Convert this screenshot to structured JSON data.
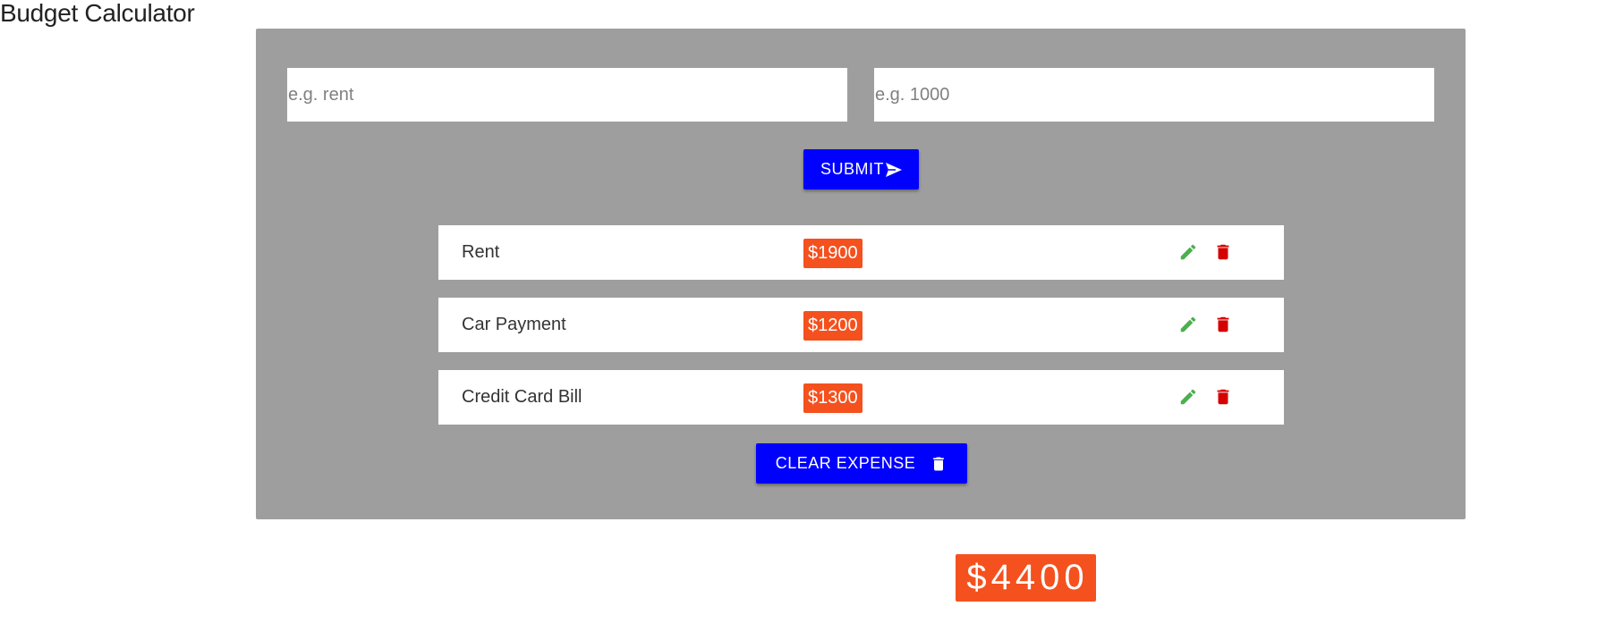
{
  "app": {
    "title": "Budget Calculator"
  },
  "form": {
    "charge_placeholder": "e.g. rent",
    "charge_value": "",
    "amount_placeholder": "e.g. 1000",
    "amount_value": "",
    "submit_label": "SUBMIT",
    "submit_icon": "send-icon"
  },
  "expenses": [
    {
      "name": "Rent",
      "amount": "$1900"
    },
    {
      "name": "Car Payment",
      "amount": "$1200"
    },
    {
      "name": "Credit Card Bill",
      "amount": "$1300"
    }
  ],
  "item_actions": {
    "edit_icon": "edit-icon",
    "delete_icon": "delete-icon"
  },
  "clear_button": {
    "label": "CLEAR EXPENSE",
    "icon": "trash-icon"
  },
  "total": {
    "value": "$4400"
  },
  "colors": {
    "panel": "#9e9e9e",
    "primary_button": "#0000ff",
    "amount_badge": "#f4511e",
    "edit_icon": "#4caf50",
    "delete_icon": "#d50000"
  }
}
